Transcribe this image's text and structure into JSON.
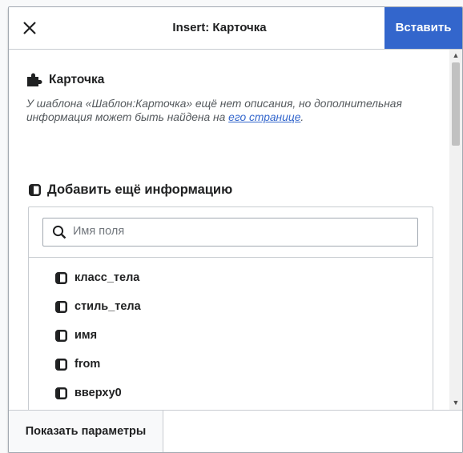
{
  "dialog": {
    "title": "Insert: Карточка",
    "insert_label": "Вставить"
  },
  "template": {
    "name": "Карточка",
    "description_prefix": "У шаблона «Шаблон:Карточка» ещё нет описания, но дополнительная информация может быть найдена на ",
    "description_link": "его странице",
    "description_suffix": "."
  },
  "add_info": {
    "heading": "Добавить ещё информацию",
    "search_placeholder": "Имя поля",
    "fields": [
      "класс_тела",
      "стиль_тела",
      "имя",
      "from",
      "вверху0"
    ]
  },
  "footer": {
    "show_params_label": "Показать параметры"
  },
  "colors": {
    "accent": "#3366cc",
    "border": "#c8ccd1",
    "text": "#202122"
  }
}
